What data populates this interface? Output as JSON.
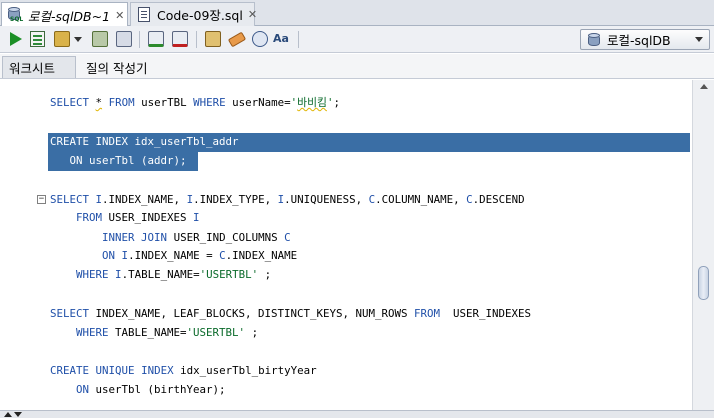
{
  "tabs": [
    {
      "label": "로컬-sqlDB~1",
      "icon": "sql-worksheet-icon",
      "active": true
    },
    {
      "label": "Code-09장.sql",
      "icon": "sql-file-icon",
      "active": false
    }
  ],
  "toolbar": {
    "icons": [
      "run-statement-icon",
      "run-script-icon",
      "commit-icon",
      "dropdown-icon",
      "autotrace-icon",
      "explain-plan-icon",
      "clear-icon",
      "rollback-icon",
      "sql-tuning-icon",
      "eraser-icon",
      "history-icon",
      "format-icon"
    ],
    "connection": {
      "label": "로컬-sqlDB",
      "icon": "database-icon"
    }
  },
  "subtabs": [
    {
      "label": "워크시트",
      "active": true
    },
    {
      "label": "질의 작성기",
      "active": false
    }
  ],
  "editor": {
    "lines": [
      {
        "text": "SELECT * FROM userTBL WHERE userName='바비킴';"
      },
      {
        "text": "CREATE INDEX idx_userTbl_addr",
        "selected": true
      },
      {
        "text": "   ON userTbl (addr);",
        "selected": true
      },
      {
        "text": "SELECT I.INDEX_NAME, I.INDEX_TYPE, I.UNIQUENESS, C.COLUMN_NAME, C.DESCEND"
      },
      {
        "text": "    FROM USER_INDEXES I"
      },
      {
        "text": "        INNER JOIN USER_IND_COLUMNS C"
      },
      {
        "text": "        ON I.INDEX_NAME = C.INDEX_NAME"
      },
      {
        "text": "    WHERE I.TABLE_NAME='USERTBL' ;"
      },
      {
        "text": "SELECT INDEX_NAME, LEAF_BLOCKS, DISTINCT_KEYS, NUM_ROWS FROM  USER_INDEXES"
      },
      {
        "text": "    WHERE TABLE_NAME='USERTBL' ;"
      },
      {
        "text": "CREATE UNIQUE INDEX idx_userTbl_birtyYear"
      },
      {
        "text": "    ON userTbl (birthYear);"
      }
    ]
  },
  "colors": {
    "keyword": "#1f4fa8",
    "string": "#0a6a2a",
    "selection": "#3a6ea5"
  }
}
